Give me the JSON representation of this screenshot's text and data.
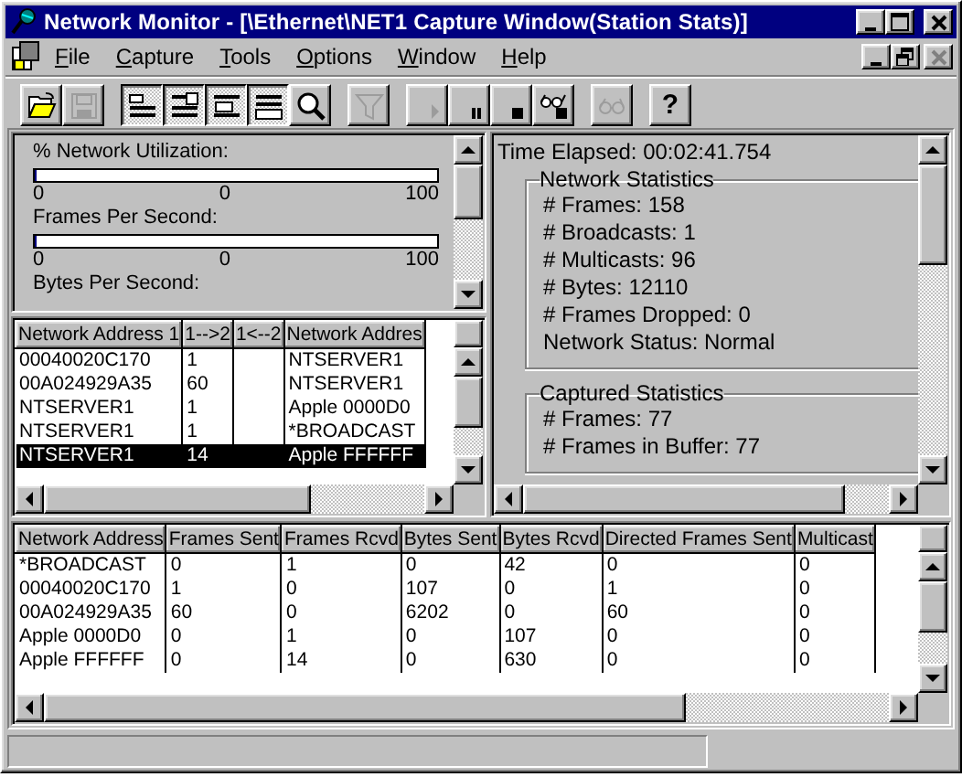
{
  "window": {
    "title": "Network Monitor - [\\Ethernet\\NET1 Capture Window(Station Stats)]"
  },
  "mdi_controls": [
    {
      "kind": "minimize",
      "disabled": false
    },
    {
      "kind": "restore",
      "disabled": false
    },
    {
      "kind": "close",
      "disabled": true
    }
  ],
  "menu": [
    {
      "label": "File"
    },
    {
      "label": "Capture"
    },
    {
      "label": "Tools"
    },
    {
      "label": "Options"
    },
    {
      "label": "Window"
    },
    {
      "label": "Help"
    }
  ],
  "toolbar": [
    {
      "buttons": [
        {
          "kind": "open",
          "disabled": false,
          "pressed": false
        },
        {
          "kind": "save",
          "disabled": true,
          "pressed": false
        }
      ]
    },
    {
      "buttons": [
        {
          "kind": "pane_graph",
          "disabled": false,
          "pressed": true
        },
        {
          "kind": "pane_session",
          "disabled": false,
          "pressed": true
        },
        {
          "kind": "pane_station",
          "disabled": false,
          "pressed": true
        },
        {
          "kind": "pane_total",
          "disabled": false,
          "pressed": true
        },
        {
          "kind": "zoom",
          "disabled": false,
          "pressed": false
        }
      ]
    },
    {
      "buttons": [
        {
          "kind": "filter",
          "disabled": true,
          "pressed": false
        }
      ]
    },
    {
      "buttons": [
        {
          "kind": "start",
          "disabled": true,
          "pressed": false
        },
        {
          "kind": "pause",
          "disabled": false,
          "pressed": false
        },
        {
          "kind": "stop",
          "disabled": false,
          "pressed": false
        },
        {
          "kind": "stop_view",
          "disabled": false,
          "pressed": false
        }
      ]
    },
    {
      "buttons": [
        {
          "kind": "view",
          "disabled": true,
          "pressed": false
        }
      ]
    },
    {
      "buttons": [
        {
          "kind": "help",
          "label": "?",
          "disabled": false,
          "pressed": false
        }
      ]
    }
  ],
  "gauges": [
    {
      "label": "% Network Utilization:",
      "level": 0,
      "scale": [
        "0",
        "0",
        "100"
      ]
    },
    {
      "label": "Frames Per Second:",
      "level": 0,
      "scale": [
        "0",
        "0",
        "100"
      ]
    }
  ],
  "next_gauge_label": "Bytes Per Second:",
  "session_table": {
    "columns": [
      "Network Address 1",
      "1-->2",
      "1<--2",
      "Network Addres"
    ],
    "rows": [
      {
        "cells": [
          "00040020C170",
          "1",
          "",
          "NTSERVER1"
        ],
        "selected": false
      },
      {
        "cells": [
          "00A024929A35",
          "60",
          "",
          "NTSERVER1"
        ],
        "selected": false
      },
      {
        "cells": [
          "NTSERVER1",
          "1",
          "",
          "Apple 0000D0"
        ],
        "selected": false
      },
      {
        "cells": [
          "NTSERVER1",
          "1",
          "",
          "*BROADCAST"
        ],
        "selected": false
      },
      {
        "cells": [
          "NTSERVER1",
          "14",
          "",
          "Apple FFFFFF"
        ],
        "selected": true
      }
    ]
  },
  "stats": {
    "time_elapsed": "Time Elapsed: 00:02:41.754",
    "groups": [
      {
        "title": "Network Statistics",
        "lines": [
          "# Frames: 158",
          "# Broadcasts: 1",
          "# Multicasts: 96",
          "# Bytes: 12110",
          "# Frames Dropped: 0",
          "Network Status: Normal"
        ]
      },
      {
        "title": "Captured Statistics",
        "lines": [
          "# Frames: 77",
          "# Frames in Buffer: 77"
        ]
      }
    ]
  },
  "station_table": {
    "columns": [
      "Network Address",
      "Frames Sent",
      "Frames Rcvd",
      "Bytes Sent",
      "Bytes Rcvd",
      "Directed Frames Sent",
      "Multicast"
    ],
    "rows": [
      {
        "cells": [
          "*BROADCAST",
          "0",
          "1",
          "0",
          "42",
          "0",
          "0"
        ],
        "selected": false
      },
      {
        "cells": [
          "00040020C170",
          "1",
          "0",
          "107",
          "0",
          "1",
          "0"
        ],
        "selected": false
      },
      {
        "cells": [
          "00A024929A35",
          "60",
          "0",
          "6202",
          "0",
          "60",
          "0"
        ],
        "selected": false
      },
      {
        "cells": [
          "Apple 0000D0",
          "0",
          "1",
          "0",
          "107",
          "0",
          "0"
        ],
        "selected": false
      },
      {
        "cells": [
          "Apple FFFFFF",
          "0",
          "14",
          "0",
          "630",
          "0",
          "0"
        ],
        "selected": false
      }
    ]
  }
}
